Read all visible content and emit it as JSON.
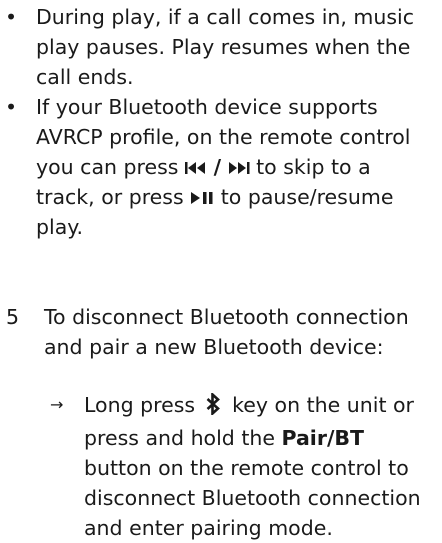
{
  "bullets": [
    {
      "symbol": "•",
      "text": "During play, if a call comes in, music play pauses. Play resumes when the call ends."
    },
    {
      "symbol": "•",
      "text_before": "If your Bluetooth device supports AVRCP profile, on the remote control you can press",
      "separator": "/",
      "text_middle": "to skip to a track, or press",
      "text_after": "to pause/resume play."
    }
  ],
  "step5": {
    "number": "5",
    "text": "To disconnect Bluetooth connection and pair a new Bluetooth device:"
  },
  "result": {
    "arrow": "→",
    "text_before": "Long press",
    "text_after_icon": "key on the unit or press and hold the",
    "button_name": "Pair/BT",
    "text_end": "button on the remote control to disconnect Bluetooth connection and enter pairing mode."
  },
  "icons": {
    "prev_icon": "previous-track-icon",
    "next_icon": "next-track-icon",
    "play_pause_icon": "play-pause-icon",
    "bluetooth_icon": "bluetooth-icon"
  }
}
